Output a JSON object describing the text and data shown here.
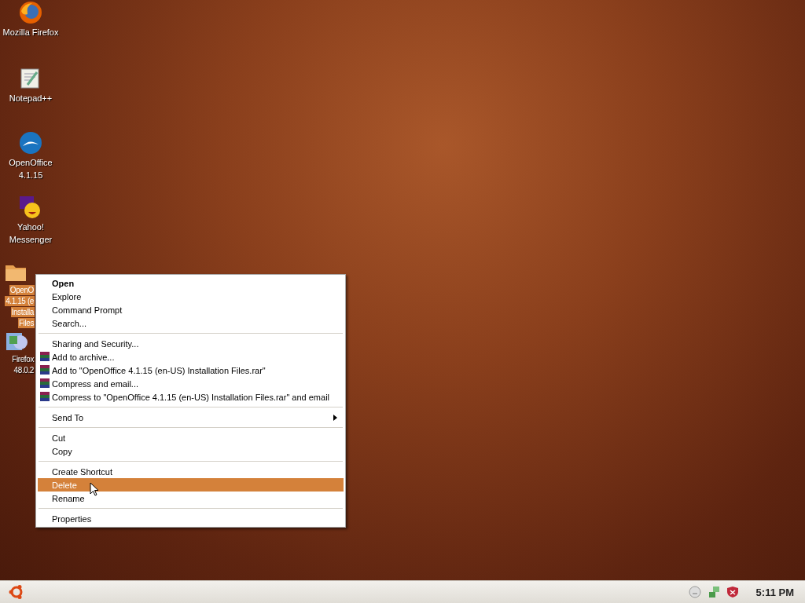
{
  "desktop_icons": [
    {
      "lines": [
        "Mozilla Firefox"
      ],
      "selected": false
    },
    {
      "lines": [
        "Notepad++"
      ],
      "selected": false
    },
    {
      "lines": [
        "OpenOffice",
        "4.1.15"
      ],
      "selected": false
    },
    {
      "lines": [
        "Yahoo!",
        "Messenger"
      ],
      "selected": false
    },
    {
      "lines": [
        "OpenO",
        "4.1.15 (e",
        "Installa",
        "Files"
      ],
      "selected": true
    },
    {
      "lines": [
        "Firefox",
        "48.0.2"
      ],
      "selected": false
    }
  ],
  "context_menu": [
    {
      "kind": "item",
      "label": "Open",
      "default": true,
      "selected": false
    },
    {
      "kind": "item",
      "label": "Explore",
      "selected": false
    },
    {
      "kind": "item",
      "label": "Command Prompt",
      "selected": false
    },
    {
      "kind": "item",
      "label": "Search...",
      "selected": false
    },
    {
      "kind": "separator"
    },
    {
      "kind": "item",
      "label": "Sharing and Security...",
      "selected": false
    },
    {
      "kind": "archive",
      "label": "Add to archive...",
      "selected": false
    },
    {
      "kind": "archive",
      "label": "Add to \"OpenOffice 4.1.15 (en-US) Installation Files.rar\"",
      "selected": false
    },
    {
      "kind": "archive",
      "label": "Compress and email...",
      "selected": false
    },
    {
      "kind": "archive",
      "label": "Compress to \"OpenOffice 4.1.15 (en-US) Installation Files.rar\" and email",
      "selected": false
    },
    {
      "kind": "separator"
    },
    {
      "kind": "submenu",
      "label": "Send To",
      "selected": false
    },
    {
      "kind": "separator"
    },
    {
      "kind": "item",
      "label": "Cut",
      "selected": false
    },
    {
      "kind": "item",
      "label": "Copy",
      "selected": false
    },
    {
      "kind": "separator"
    },
    {
      "kind": "item",
      "label": "Create Shortcut",
      "selected": false
    },
    {
      "kind": "item",
      "label": "Delete",
      "selected": true
    },
    {
      "kind": "item",
      "label": "Rename",
      "selected": false
    },
    {
      "kind": "separator"
    },
    {
      "kind": "item",
      "label": "Properties",
      "selected": false
    }
  ],
  "taskbar": {
    "clock": "5:11 PM"
  }
}
